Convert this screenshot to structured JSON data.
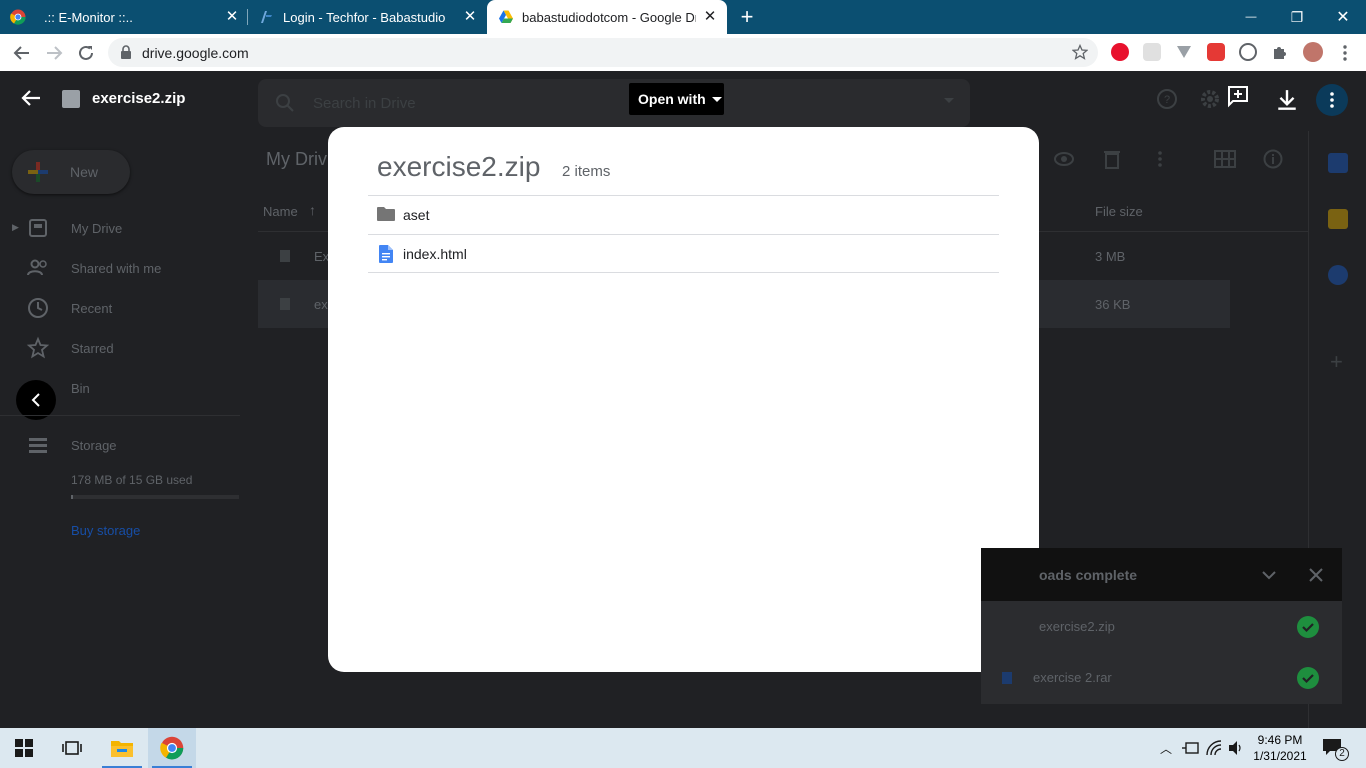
{
  "browser": {
    "tabs": [
      {
        "title": ".:: E-Monitor ::..",
        "icon": "chrome-favicon"
      },
      {
        "title": "Login - Techfor - Babastudio",
        "icon": "techfor-favicon"
      },
      {
        "title": "babastudiodotcom - Google Drive",
        "icon": "google-drive-favicon",
        "active": true
      }
    ],
    "new_tab_symbol": "+",
    "window_controls": {
      "minimize": "—",
      "restore": "❐",
      "close": "✕"
    },
    "url": "drive.google.com"
  },
  "drive": {
    "new_label": "New",
    "sidebar": [
      {
        "label": "My Drive",
        "icon": "drive-icon"
      },
      {
        "label": "Shared with me",
        "icon": "people-icon"
      },
      {
        "label": "Recent",
        "icon": "clock-icon"
      },
      {
        "label": "Starred",
        "icon": "star-icon"
      },
      {
        "label": "Bin",
        "icon": "trash-icon"
      }
    ],
    "storage_label": "Storage",
    "storage_used": "178 MB of 15 GB used",
    "buy_storage": "Buy storage",
    "search_placeholder": "Search in Drive",
    "breadcrumb": "My Driv",
    "columns": {
      "name": "Name",
      "file_size": "File size"
    },
    "rows": [
      {
        "name": "Ex",
        "size": "3 MB"
      },
      {
        "name": "ex",
        "size": "36 KB"
      }
    ]
  },
  "viewer": {
    "file_name": "exercise2.zip",
    "open_with": "Open with"
  },
  "zip_dialog": {
    "title": "exercise2.zip",
    "count": "2 items",
    "items": [
      {
        "name": "aset",
        "icon": "folder-icon"
      },
      {
        "name": "index.html",
        "icon": "doc-icon"
      }
    ]
  },
  "downloads": {
    "header": "oads complete",
    "items": [
      {
        "name": "exercise2.zip"
      },
      {
        "name": "exercise 2.rar"
      }
    ]
  },
  "taskbar": {
    "time": "9:46 PM",
    "date": "1/31/2021",
    "notification_count": "2"
  },
  "colors": {
    "tab_strip": "#0b4f71",
    "drive_blue": "#1a73e8",
    "success_green": "#1e8e3e"
  }
}
